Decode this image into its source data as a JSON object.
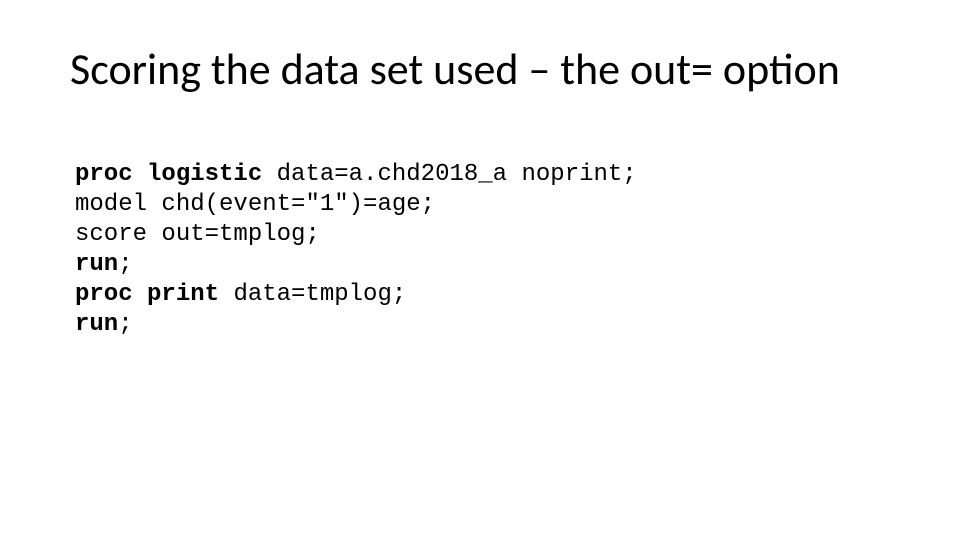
{
  "title": "Scoring the data set used – the out= option",
  "code": {
    "l1": {
      "a": "proc",
      "b": "logistic",
      "c": "data",
      "d": "=a.chd2018_a noprint;"
    },
    "l2": {
      "a": "model chd(event=\"1\")=age;"
    },
    "l3": {
      "a": "score out=tmplog;"
    },
    "l4": {
      "a": "run",
      "b": ";"
    },
    "l5": {
      "a": "proc",
      "b": "print",
      "c": "data",
      "d": "=tmplog;"
    },
    "l6": {
      "a": "run",
      "b": ";"
    }
  }
}
